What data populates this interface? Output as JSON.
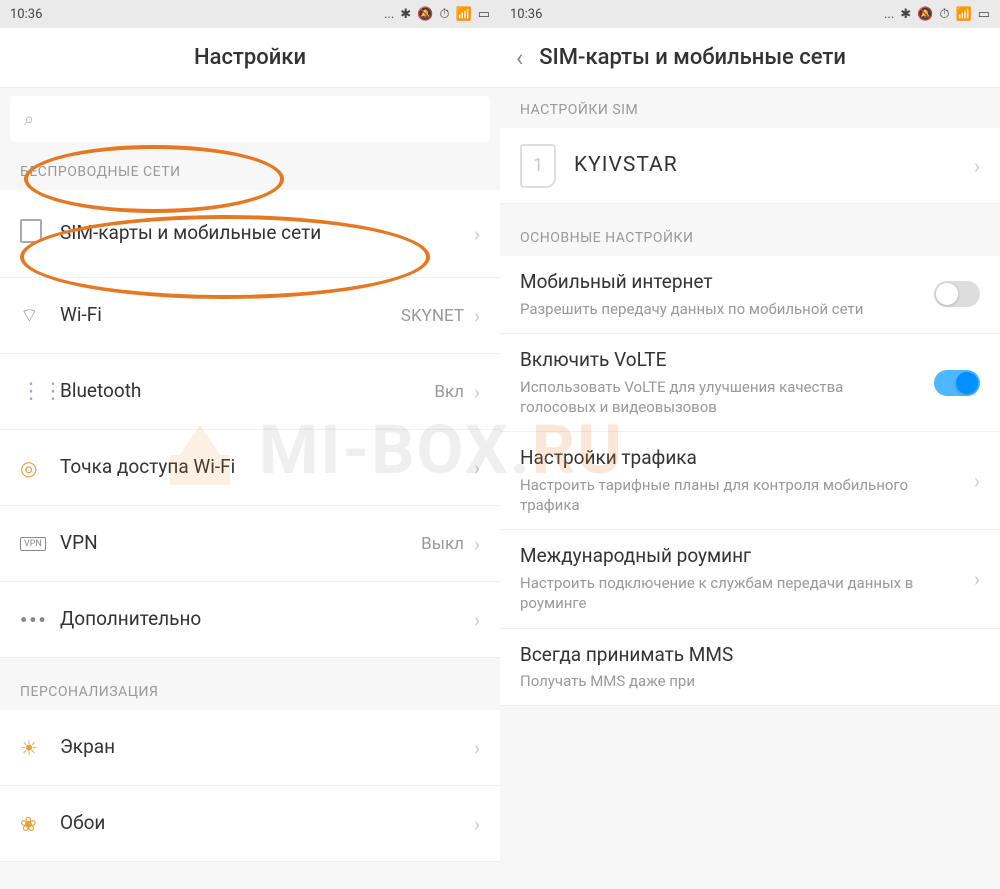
{
  "status": {
    "time": "10:36",
    "icons": [
      "...",
      "✱",
      "🔕",
      "✈",
      "📶",
      "🔲"
    ]
  },
  "left": {
    "header_title": "Настройки",
    "sections": {
      "wireless": {
        "header": "БЕСПРОВОДНЫЕ СЕТИ",
        "items": [
          {
            "title": "SIM-карты и мобильные сети",
            "value": "",
            "icon": "sim"
          },
          {
            "title": "Wi-Fi",
            "value": "SKYNET",
            "icon": "wifi"
          },
          {
            "title": "Bluetooth",
            "value": "Вкл",
            "icon": "bluetooth"
          },
          {
            "title": "Точка доступа Wi-Fi",
            "value": "",
            "icon": "hotspot"
          },
          {
            "title": "VPN",
            "value": "Выкл",
            "icon": "vpn"
          },
          {
            "title": "Дополнительно",
            "value": "",
            "icon": "more"
          }
        ]
      },
      "personalization": {
        "header": "ПЕРСОНАЛИЗАЦИЯ",
        "items": [
          {
            "title": "Экран",
            "value": "",
            "icon": "display"
          },
          {
            "title": "Обои",
            "value": "",
            "icon": "wallpaper"
          }
        ]
      }
    }
  },
  "right": {
    "header_title": "SIM-карты и мобильные сети",
    "sim_section": {
      "header": "НАСТРОЙКИ SIM",
      "sim_number": "1",
      "sim_name": "KYIVSTAR"
    },
    "main_section": {
      "header": "ОСНОВНЫЕ НАСТРОЙКИ",
      "items": [
        {
          "title": "Мобильный интернет",
          "subtitle": "Разрешить передачу данных по мобильной сети",
          "toggle": false
        },
        {
          "title": "Включить VoLTE",
          "subtitle": "Использовать VoLTE для улучшения качества голосовых и видеовызовов",
          "toggle": true
        },
        {
          "title": "Настройки трафика",
          "subtitle": "Настроить тарифные планы для контроля мобильного трафика"
        },
        {
          "title": "Международный роуминг",
          "subtitle": "Настроить подключение к службам передачи данных в роуминге"
        },
        {
          "title": "Всегда принимать MMS",
          "subtitle": "Получать MMS даже при"
        }
      ]
    }
  },
  "watermark": {
    "text1": "MI-BOX.",
    "text2": "RU"
  }
}
